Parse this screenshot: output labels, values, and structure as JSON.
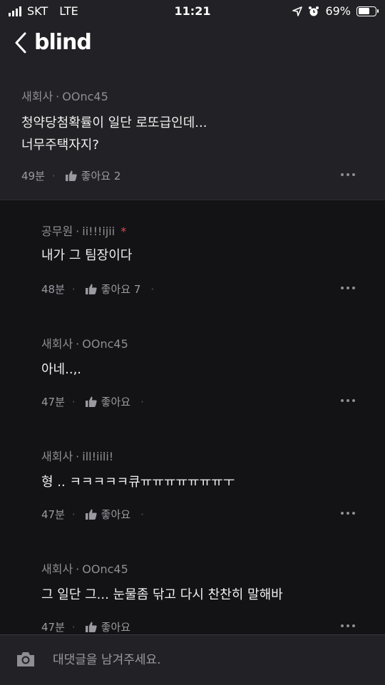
{
  "status_bar": {
    "carrier": "SKT",
    "network": "LTE",
    "time": "11:21",
    "battery_pct": "69%",
    "battery_level": 0.69
  },
  "nav": {
    "logo": "blind"
  },
  "main_comment": {
    "company": "새회사",
    "separator": "·",
    "nickname": "OOnc45",
    "text": "청약당첨확률이 일단 로또급인데...\n너무주택자지?",
    "time_ago": "49분",
    "like_label": "좋아요 2"
  },
  "replies": [
    {
      "company": "공무원",
      "separator": "·",
      "nickname": "ii!!!ijii",
      "badge": "*",
      "text": "내가 그 팀장이다",
      "time_ago": "48분",
      "like_label": "좋아요 7"
    },
    {
      "company": "새회사",
      "separator": "·",
      "nickname": "OOnc45",
      "badge": "",
      "text": "아네..,.",
      "time_ago": "47분",
      "like_label": "좋아요"
    },
    {
      "company": "새회사",
      "separator": "·",
      "nickname": "ill!iili!",
      "badge": "",
      "text": "형 ..  ㅋㅋㅋㅋㅋ큐ㅠㅠㅠㅠㅠㅠㅠㅜ",
      "time_ago": "47분",
      "like_label": "좋아요"
    },
    {
      "company": "새회사",
      "separator": "·",
      "nickname": "OOnc45",
      "badge": "",
      "text": "그 일단 그... 눈물좀 닦고 다시 찬찬히 말해바",
      "time_ago": "47분",
      "like_label": "좋아요"
    }
  ],
  "input": {
    "placeholder": "대댓글을 남겨주세요."
  }
}
